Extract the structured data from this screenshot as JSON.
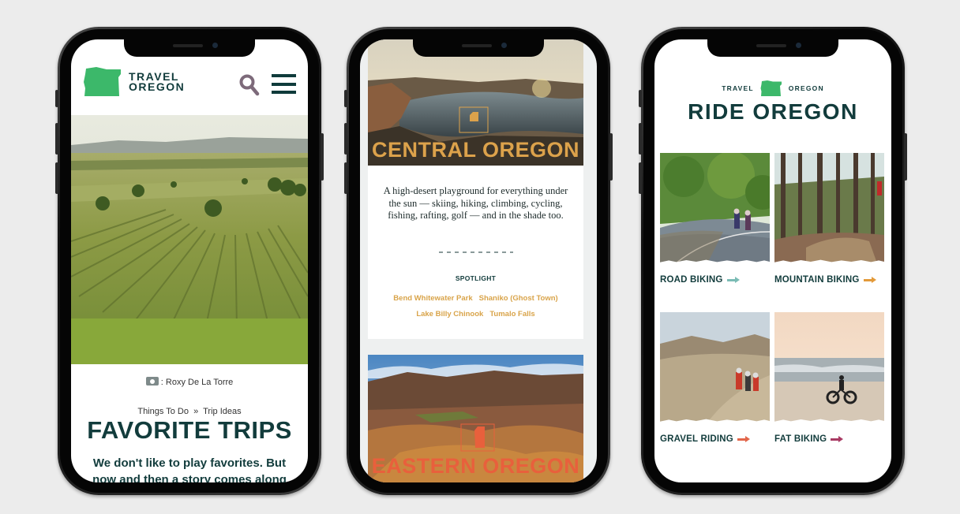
{
  "phone1": {
    "logo_line1": "TRAVEL",
    "logo_line2": "OREGON",
    "photo_credit": ": Roxy De La Torre",
    "breadcrumb": [
      "Things To Do",
      "»",
      "Trip Ideas"
    ],
    "title": "FAVORITE TRIPS",
    "body": "We don't like to play favorites. But now and then a story comes along",
    "icons": [
      "oregon-logo-icon",
      "search-icon",
      "hamburger-menu-icon",
      "camera-icon"
    ]
  },
  "phone2": {
    "hero_title": "CENTRAL OREGON",
    "description": "A high-desert playground for everything under the sun — skiing, hiking, climbing, cycling, fishing, rafting, golf — and in the shade too.",
    "spotlight_heading": "SPOTLIGHT",
    "spotlight_links": [
      "Bend Whitewater Park",
      "Shaniko (Ghost Town)",
      "Lake Billy Chinook",
      "Tumalo Falls"
    ],
    "second_title": "EASTERN OREGON",
    "colors": {
      "central": "#dca24b",
      "eastern": "#e8603c",
      "link": "#d9a44a"
    }
  },
  "phone3": {
    "brand_left": "TRAVEL",
    "brand_right": "OREGON",
    "title": "RIDE OREGON",
    "tiles": [
      {
        "label": "ROAD BIKING",
        "arrow_color": "#7bbcb5"
      },
      {
        "label": "MOUNTAIN BIKING",
        "arrow_color": "#e39a3a"
      },
      {
        "label": "GRAVEL RIDING",
        "arrow_color": "#e2664a"
      },
      {
        "label": "FAT BIKING",
        "arrow_color": "#a83a63"
      }
    ]
  },
  "theme": {
    "brand_green": "#3cb86a",
    "dark_teal": "#123c3c"
  }
}
